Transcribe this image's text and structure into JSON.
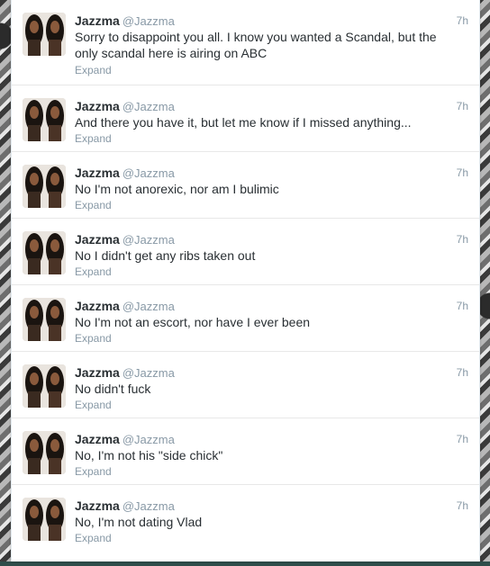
{
  "tweets": [
    {
      "name": "Jazzma",
      "handle": "@Jazzma",
      "time": "7h",
      "text": "Sorry to disappoint you all. I know you wanted a Scandal, but the only scandal here is airing on ABC",
      "expand": "Expand"
    },
    {
      "name": "Jazzma",
      "handle": "@Jazzma",
      "time": "7h",
      "text": "And there you have it, but let me know if I missed anything...",
      "expand": "Expand"
    },
    {
      "name": "Jazzma",
      "handle": "@Jazzma",
      "time": "7h",
      "text": "No I'm not anorexic, nor am I bulimic",
      "expand": "Expand"
    },
    {
      "name": "Jazzma",
      "handle": "@Jazzma",
      "time": "7h",
      "text": "No I didn't get any ribs taken out",
      "expand": "Expand"
    },
    {
      "name": "Jazzma",
      "handle": "@Jazzma",
      "time": "7h",
      "text": "No I'm not an escort, nor have I ever been",
      "expand": "Expand"
    },
    {
      "name": "Jazzma",
      "handle": "@Jazzma",
      "time": "7h",
      "text": "No didn't fuck",
      "expand": "Expand"
    },
    {
      "name": "Jazzma",
      "handle": "@Jazzma",
      "time": "7h",
      "text": "No, I'm not his \"side chick\"",
      "expand": "Expand"
    },
    {
      "name": "Jazzma",
      "handle": "@Jazzma",
      "time": "7h",
      "text": "No, I'm not dating Vlad",
      "expand": "Expand"
    }
  ],
  "colors": {
    "name": "#292f33",
    "meta": "#8899a6",
    "card": "#ffffff"
  },
  "icons": {
    "avatar": "profile-photo-icon"
  }
}
